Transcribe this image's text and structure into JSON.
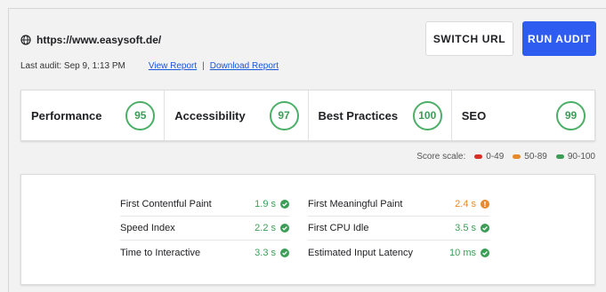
{
  "header": {
    "url": "https://www.easysoft.de/",
    "last_audit_label": "Last audit: Sep 9, 1:13 PM",
    "view_report": "View Report",
    "separator": "|",
    "download_report": "Download Report",
    "switch_url": "SWITCH URL",
    "run_audit": "RUN AUDIT"
  },
  "scores": [
    {
      "name": "Performance",
      "value": "95"
    },
    {
      "name": "Accessibility",
      "value": "97"
    },
    {
      "name": "Best Practices",
      "value": "100"
    },
    {
      "name": "SEO",
      "value": "99"
    }
  ],
  "score_scale": {
    "label": "Score scale:",
    "poor": "0-49",
    "average": "50-89",
    "good": "90-100"
  },
  "metrics": {
    "left": [
      {
        "name": "First Contentful Paint",
        "value": "1.9 s"
      },
      {
        "name": "Speed Index",
        "value": "2.2 s"
      },
      {
        "name": "Time to Interactive",
        "value": "3.3 s"
      }
    ],
    "right": [
      {
        "name": "First Meaningful Paint",
        "value": "2.4 s"
      },
      {
        "name": "First CPU Idle",
        "value": "3.5 s"
      },
      {
        "name": "Estimated Input Latency",
        "value": "10 ms"
      }
    ]
  },
  "colors": {
    "accent": "#2f5cf0",
    "good": "#3c9d57",
    "average": "#e8892b",
    "poor": "#d93025"
  }
}
